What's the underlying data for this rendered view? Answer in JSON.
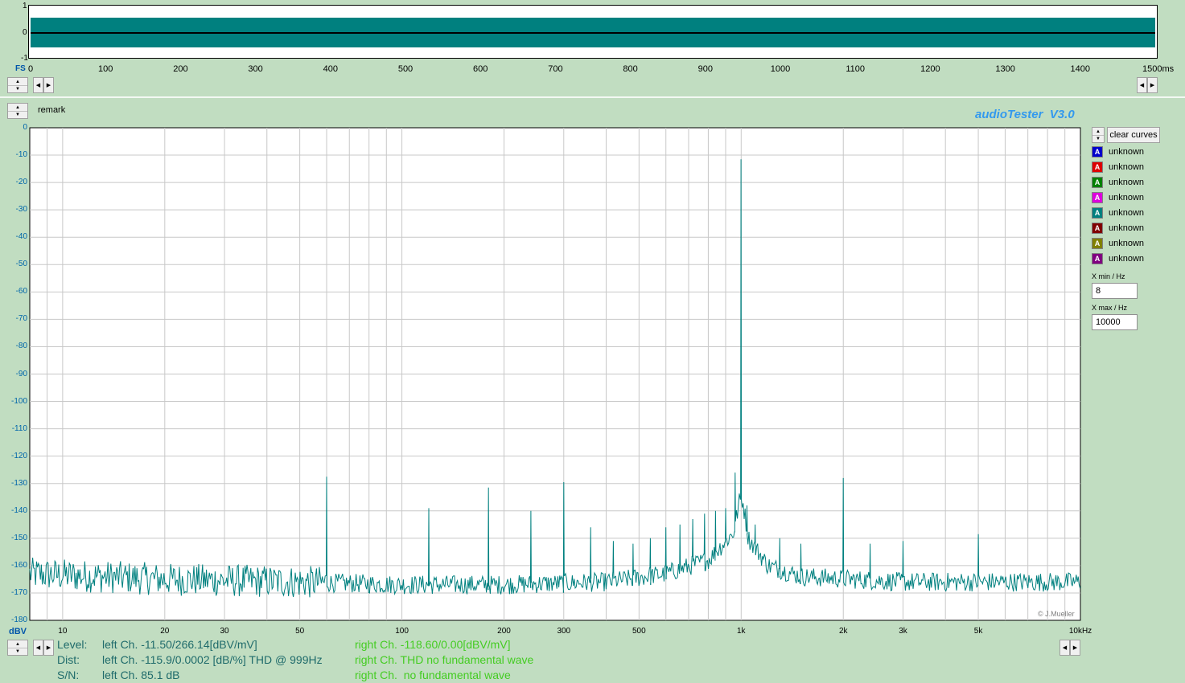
{
  "waveform": {
    "ylabels": [
      "1",
      "0",
      "-1"
    ],
    "fs_label": "FS",
    "xticks": [
      "0",
      "100",
      "200",
      "300",
      "400",
      "500",
      "600",
      "700",
      "800",
      "900",
      "1000",
      "1100",
      "1200",
      "1300",
      "1400",
      "1500ms"
    ]
  },
  "remark": "remark",
  "brand": "audioTester  V3.0",
  "copyright": "© J.Mueller",
  "chart_data": {
    "type": "line",
    "title": "",
    "xlabel": "",
    "ylabel": "dBV",
    "x_scale": "log",
    "xlim": [
      8,
      10000
    ],
    "ylim": [
      -180,
      0
    ],
    "grid": true,
    "yticks": [
      "0",
      "-10",
      "-20",
      "-30",
      "-40",
      "-50",
      "-60",
      "-70",
      "-80",
      "-90",
      "-100",
      "-110",
      "-120",
      "-130",
      "-140",
      "-150",
      "-160",
      "-170",
      "-180"
    ],
    "xticks": [
      {
        "v": 10,
        "label": "10"
      },
      {
        "v": 20,
        "label": "20"
      },
      {
        "v": 30,
        "label": "30"
      },
      {
        "v": 50,
        "label": "50"
      },
      {
        "v": 100,
        "label": "100"
      },
      {
        "v": 200,
        "label": "200"
      },
      {
        "v": 300,
        "label": "300"
      },
      {
        "v": 500,
        "label": "500"
      },
      {
        "v": 1000,
        "label": "1k"
      },
      {
        "v": 2000,
        "label": "2k"
      },
      {
        "v": 3000,
        "label": "3k"
      },
      {
        "v": 5000,
        "label": "5k"
      },
      {
        "v": 10000,
        "label": "10kHz"
      }
    ],
    "series": [
      {
        "color": "#00807f",
        "noise_floor": [
          [
            8,
            -163
          ],
          [
            20,
            -165
          ],
          [
            50,
            -166
          ],
          [
            100,
            -167
          ],
          [
            200,
            -167
          ],
          [
            400,
            -166
          ],
          [
            600,
            -163
          ],
          [
            800,
            -158
          ],
          [
            950,
            -148
          ],
          [
            990,
            -136
          ],
          [
            1010,
            -136
          ],
          [
            1050,
            -150
          ],
          [
            1200,
            -160
          ],
          [
            1500,
            -164
          ],
          [
            3000,
            -166
          ],
          [
            10000,
            -166
          ]
        ],
        "peaks": [
          {
            "x": 60,
            "y": -127.5
          },
          {
            "x": 120,
            "y": -139
          },
          {
            "x": 180,
            "y": -131.5
          },
          {
            "x": 240,
            "y": -140
          },
          {
            "x": 300,
            "y": -129.5
          },
          {
            "x": 360,
            "y": -146
          },
          {
            "x": 420,
            "y": -151
          },
          {
            "x": 480,
            "y": -152
          },
          {
            "x": 540,
            "y": -150
          },
          {
            "x": 600,
            "y": -146
          },
          {
            "x": 660,
            "y": -145
          },
          {
            "x": 720,
            "y": -143
          },
          {
            "x": 780,
            "y": -141
          },
          {
            "x": 840,
            "y": -140
          },
          {
            "x": 900,
            "y": -139
          },
          {
            "x": 960,
            "y": -126
          },
          {
            "x": 999,
            "y": -11.5
          },
          {
            "x": 1040,
            "y": -138
          },
          {
            "x": 1100,
            "y": -145
          },
          {
            "x": 1300,
            "y": -150
          },
          {
            "x": 1500,
            "y": -152
          },
          {
            "x": 2000,
            "y": -128
          },
          {
            "x": 2400,
            "y": -152
          },
          {
            "x": 3000,
            "y": -151
          },
          {
            "x": 5000,
            "y": -148.5
          }
        ]
      }
    ]
  },
  "curves": {
    "clear_label": "clear curves",
    "items": [
      {
        "label": "unknown",
        "color": "#0000cc"
      },
      {
        "label": "unknown",
        "color": "#dd0000"
      },
      {
        "label": "unknown",
        "color": "#008000"
      },
      {
        "label": "unknown",
        "color": "#dd00dd"
      },
      {
        "label": "unknown",
        "color": "#00807f"
      },
      {
        "label": "unknown",
        "color": "#800000"
      },
      {
        "label": "unknown",
        "color": "#808000"
      },
      {
        "label": "unknown",
        "color": "#800080"
      }
    ],
    "letter": "A"
  },
  "xrange": {
    "min_label": "X min / Hz",
    "min_value": "8",
    "max_label": "X max / Hz",
    "max_value": "10000"
  },
  "stats": {
    "level_label": "Level:",
    "level_left": "left Ch. -11.50/266.14[dBV/mV]",
    "level_right": "right Ch. -118.60/0.00[dBV/mV]",
    "dist_label": "Dist:",
    "dist_left": "left Ch. -115.9/0.0002 [dB/%] THD @ 999Hz",
    "dist_right": "right Ch. THD no fundamental wave",
    "sn_label": "S/N:",
    "sn_left": "left Ch. 85.1 dB",
    "sn_right": "right Ch.  no fundamental wave"
  },
  "colors": {
    "background": "#c1ddc1",
    "trace": "#00807f",
    "stat_left": "#1f6b6b",
    "stat_right": "#44cc22",
    "brand": "#3399ee"
  }
}
